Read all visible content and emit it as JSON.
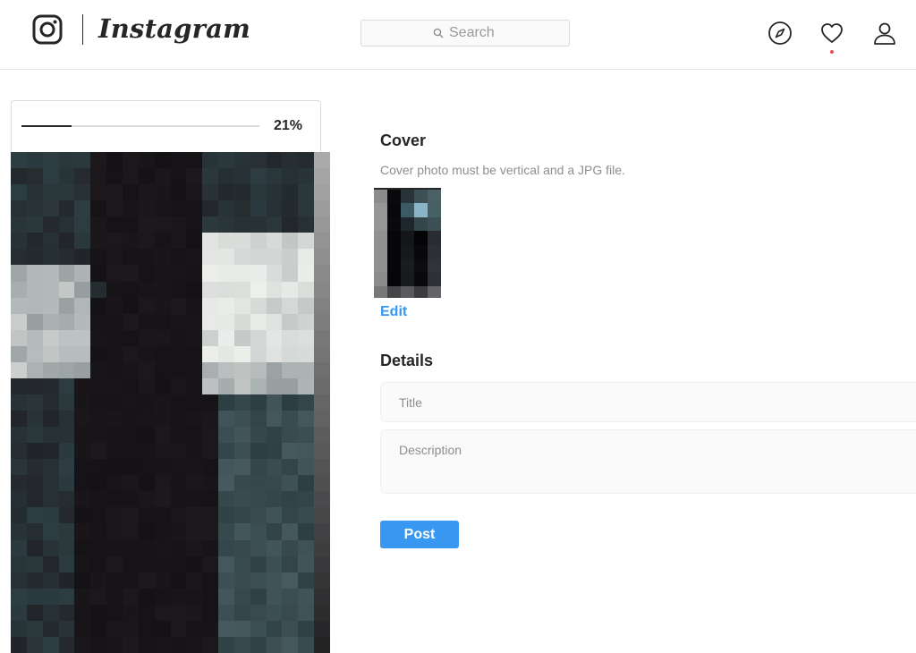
{
  "header": {
    "wordmark": "Instagram",
    "search": {
      "placeholder": "Search",
      "value": ""
    },
    "icons": [
      "instagram-camera-icon",
      "compass-icon",
      "heart-icon",
      "profile-icon",
      "search-icon"
    ],
    "has_activity_notification": true
  },
  "upload": {
    "progress_text": "21%",
    "progress_fraction": 0.21
  },
  "cover": {
    "heading": "Cover",
    "note": "Cover photo must be vertical and a JPG file.",
    "edit_label": "Edit"
  },
  "details": {
    "heading": "Details",
    "title_placeholder": "Title",
    "description_placeholder": "Description"
  },
  "actions": {
    "post_label": "Post"
  },
  "colors": {
    "accent": "#3897f0",
    "text": "#262626",
    "muted": "#8e8e8e",
    "notification": "#ed4956",
    "field_bg": "#fafafa"
  }
}
